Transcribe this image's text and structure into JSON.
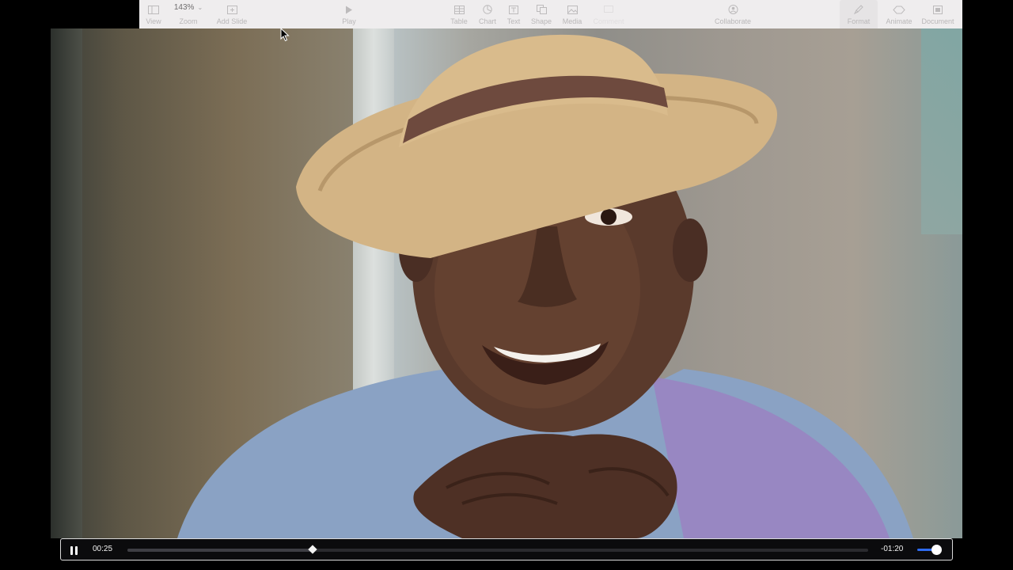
{
  "toolbar": {
    "view": {
      "label": "View",
      "icon": "sidebar-icon"
    },
    "zoom": {
      "value": "143%",
      "label": "Zoom",
      "icon": "chevron-down-icon"
    },
    "add_slide": {
      "label": "Add Slide",
      "icon": "add-slide-icon"
    },
    "play": {
      "label": "Play",
      "icon": "play-icon"
    },
    "table": {
      "label": "Table",
      "icon": "table-icon"
    },
    "chart": {
      "label": "Chart",
      "icon": "chart-icon"
    },
    "text": {
      "label": "Text",
      "icon": "text-icon"
    },
    "shape": {
      "label": "Shape",
      "icon": "shape-icon"
    },
    "media": {
      "label": "Media",
      "icon": "media-icon"
    },
    "comment": {
      "label": "Comment",
      "icon": "comment-icon"
    },
    "collaborate": {
      "label": "Collaborate",
      "icon": "collaborate-icon"
    },
    "format": {
      "label": "Format",
      "icon": "format-brush-icon"
    },
    "animate": {
      "label": "Animate",
      "icon": "animate-icon"
    },
    "document": {
      "label": "Document",
      "icon": "document-icon"
    }
  },
  "player": {
    "current_time": "00:25",
    "remaining_time": "-01:20",
    "progress_fraction": 0.25,
    "volume_fraction": 0.85,
    "state": "playing",
    "accent_color": "#2e6bf0"
  },
  "colors": {
    "toolbar_bg": "#efedee",
    "controls_bg": "#0b0b0d"
  }
}
